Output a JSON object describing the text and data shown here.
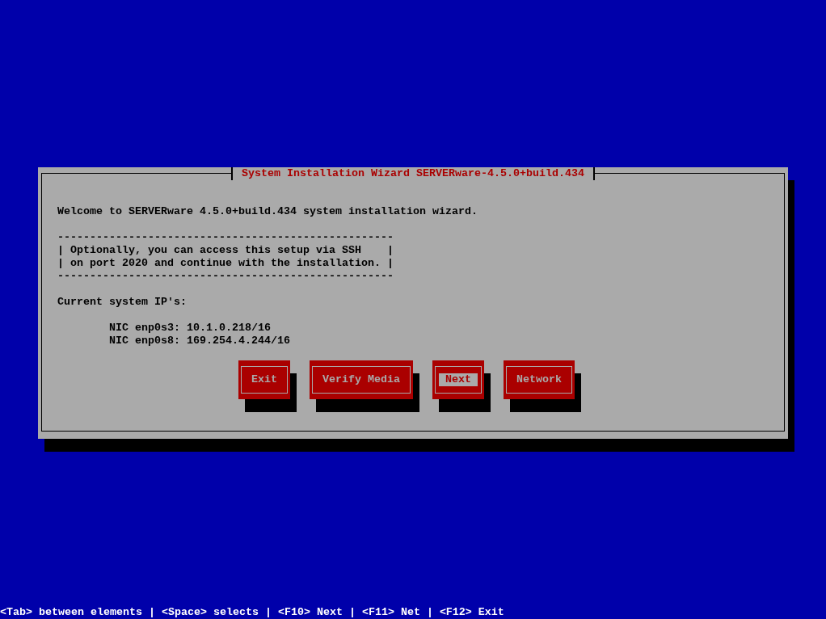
{
  "dialog": {
    "title": "System Installation Wizard SERVERware-4.5.0+build.434",
    "welcome": "Welcome to SERVERware 4.5.0+build.434 system installation wizard.",
    "notice_lines": [
      "----------------------------------------------------",
      "| Optionally, you can access this setup via SSH    |",
      "| on port 2020 and continue with the installation. |",
      "----------------------------------------------------"
    ],
    "ip_heading": "Current system IP's:",
    "nic_lines": [
      "NIC enp0s3: 10.1.0.218/16",
      "NIC enp0s8: 169.254.4.244/16"
    ],
    "buttons": [
      {
        "label": "Exit",
        "selected": false
      },
      {
        "label": "Verify Media",
        "selected": false
      },
      {
        "label": "Next",
        "selected": true
      },
      {
        "label": "Network",
        "selected": false
      }
    ]
  },
  "status_bar": "<Tab> between elements | <Space> selects | <F10> Next | <F11> Net | <F12> Exit"
}
